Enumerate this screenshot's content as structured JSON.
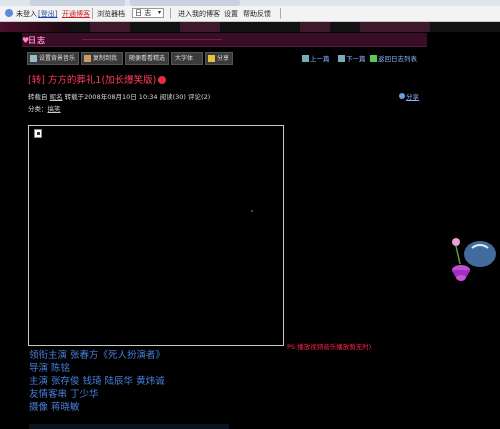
{
  "browser": {
    "toolbar": {
      "user": "未登入",
      "login_link": "[登出]",
      "signup_link": "开通博客",
      "dropdown_label": "浏览器档",
      "dropdown_value": "日 志",
      "enter_profile": "进入我的博客",
      "settings": "设置",
      "help": "帮助反馈"
    }
  },
  "blog": {
    "logo": "日志",
    "actions": {
      "btn1": "设置背景音乐",
      "btn2": "复制到我",
      "btn3": "随便看看精选",
      "btn4": "大字体",
      "btn5": "分享"
    },
    "nav": {
      "prev": "上一篇",
      "next": "下一篇",
      "back": "返回日志列表"
    },
    "post": {
      "title": "[转] 方方的葬礼1(加长爆笑版)",
      "meta": {
        "prefix": "转载自",
        "author": "昵名",
        "posted": "转载于2008年08月10日 10:34",
        "reads": "阅读(30)",
        "comments": "评论(2)"
      },
      "share": "分享",
      "category_label": "分类：",
      "category": "搞笑"
    },
    "ps_note": "PS:播放视频音乐播放暂无时)",
    "credits": [
      "领衔主演  张春方《死人扮演者》",
      "导演  陈铭",
      "主演  张存俊  钱琦  陆辰华  黄炜诚",
      "友情客串  丁少华",
      "摄像  蒋晓敏"
    ]
  },
  "colors": {
    "background": "#000000",
    "title": "#ff3b5c",
    "credits": "#4a7fdf",
    "link": "#8ab4ff",
    "ps_note": "#ff2244"
  }
}
